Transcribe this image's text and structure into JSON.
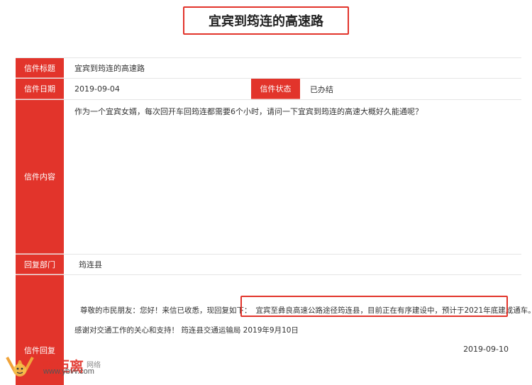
{
  "page_title": "宜宾到筠连的高速路",
  "fields": {
    "title_label": "信件标题",
    "title_value": "宜宾到筠连的高速路",
    "date_label": "信件日期",
    "date_value": "2019-09-04",
    "status_label": "信件状态",
    "status_value": "已办结",
    "content_label": "信件内容",
    "content_value": "作为一个宜宾女婿，每次回开车回筠连都需要6个小时，请问一下宜宾到筠连的高速大概好久能通呢？",
    "dept_label": "回复部门",
    "dept_value": "筠连县",
    "reply_label": "信件回复",
    "reply_greeting": "尊敬的市民朋友：您好！来信已收悉，现回复如下：",
    "reply_highlight": "宜宾至彝良高速公路途径筠连县，目前正在有序建设中，预计于2021年底建成通车。",
    "reply_thanks": "感谢对交通工作的关心和支持！ 筠连县交通运输局 2019年9月10日",
    "reply_date": "2019-09-10"
  },
  "watermark": {
    "brand": "零距离",
    "suffix": "网络",
    "url": "www.ybvv.com"
  },
  "colors": {
    "accent": "#e2342b",
    "border": "#e5e5e5"
  }
}
